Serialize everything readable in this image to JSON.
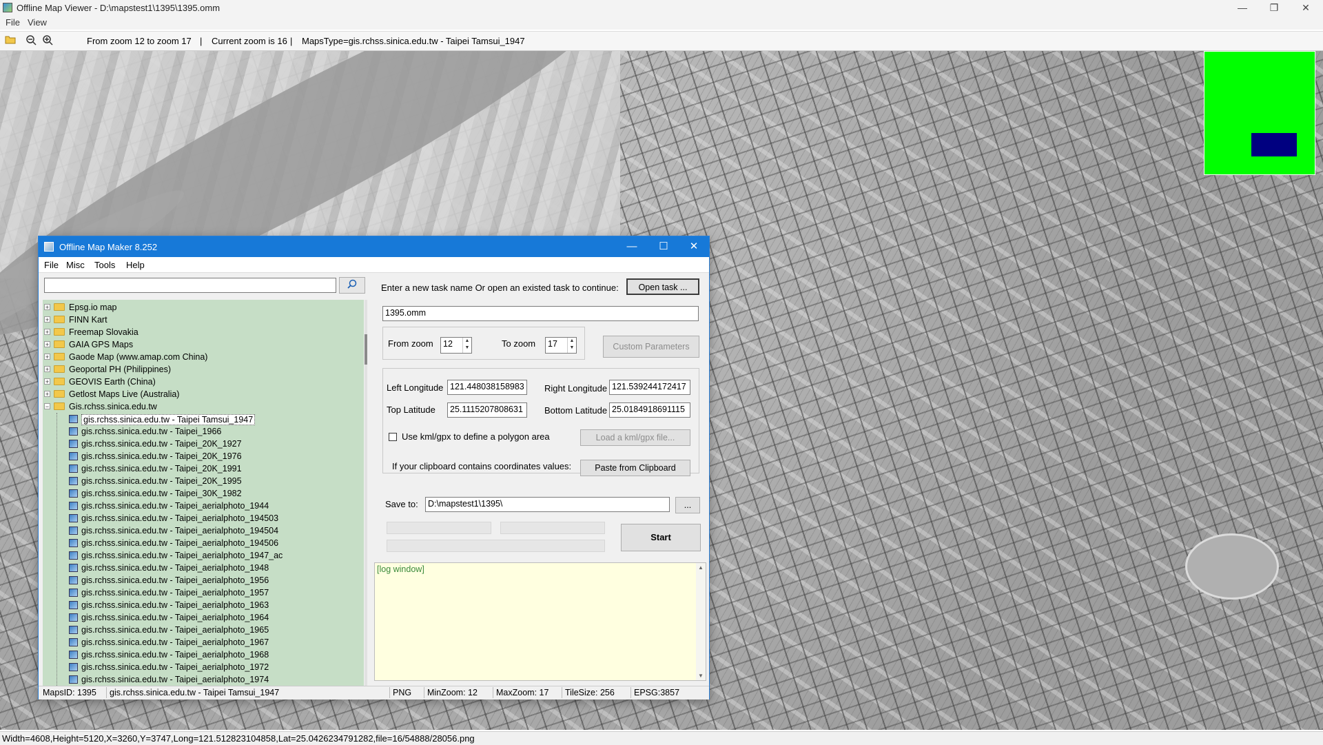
{
  "main_window": {
    "title": "Offline Map Viewer - D:\\mapstest1\\1395\\1395.omm",
    "menu": [
      "File",
      "View"
    ],
    "toolbar": {
      "zoom_range": "From zoom 12 to zoom 17",
      "current_zoom": "Current zoom is 16",
      "maps_type": "MapsType=gis.rchss.sinica.edu.tw - Taipei Tamsui_1947",
      "sep1": "|",
      "sep2": "|"
    },
    "window_controls": {
      "minimize": "—",
      "restore": "❐",
      "close": "✕"
    },
    "status": "Width=4608,Height=5120,X=3260,Y=3747,Long=121.512823104858,Lat=25.0426234791282,file=16/54888/28056.png",
    "minimap_colors": {
      "background": "#00ff00",
      "viewport": "#000080"
    }
  },
  "dialog": {
    "title": "Offline Map Maker 8.252",
    "menu": [
      "File",
      "Misc",
      "Tools",
      "Help"
    ],
    "search": {
      "value": "",
      "icon": "search-icon"
    },
    "tree": {
      "folders": [
        "Epsg.io map",
        "FINN Kart",
        "Freemap Slovakia",
        "GAIA GPS Maps",
        "Gaode Map (www.amap.com China)",
        "Geoportal PH (Philippines)",
        "GEOVIS Earth (China)",
        "Getlost Maps Live (Australia)"
      ],
      "expanded_folder": "Gis.rchss.sinica.edu.tw",
      "children": [
        "gis.rchss.sinica.edu.tw - Taipei Tamsui_1947",
        "gis.rchss.sinica.edu.tw - Taipei_1966",
        "gis.rchss.sinica.edu.tw - Taipei_20K_1927",
        "gis.rchss.sinica.edu.tw - Taipei_20K_1976",
        "gis.rchss.sinica.edu.tw - Taipei_20K_1991",
        "gis.rchss.sinica.edu.tw - Taipei_20K_1995",
        "gis.rchss.sinica.edu.tw - Taipei_30K_1982",
        "gis.rchss.sinica.edu.tw - Taipei_aerialphoto_1944",
        "gis.rchss.sinica.edu.tw - Taipei_aerialphoto_194503",
        "gis.rchss.sinica.edu.tw - Taipei_aerialphoto_194504",
        "gis.rchss.sinica.edu.tw - Taipei_aerialphoto_194506",
        "gis.rchss.sinica.edu.tw - Taipei_aerialphoto_1947_ac",
        "gis.rchss.sinica.edu.tw - Taipei_aerialphoto_1948",
        "gis.rchss.sinica.edu.tw - Taipei_aerialphoto_1956",
        "gis.rchss.sinica.edu.tw - Taipei_aerialphoto_1957",
        "gis.rchss.sinica.edu.tw - Taipei_aerialphoto_1963",
        "gis.rchss.sinica.edu.tw - Taipei_aerialphoto_1964",
        "gis.rchss.sinica.edu.tw - Taipei_aerialphoto_1965",
        "gis.rchss.sinica.edu.tw - Taipei_aerialphoto_1967",
        "gis.rchss.sinica.edu.tw - Taipei_aerialphoto_1968",
        "gis.rchss.sinica.edu.tw - Taipei_aerialphoto_1972",
        "gis.rchss.sinica.edu.tw - Taipei_aerialphoto_1974"
      ],
      "selected_index": 0
    },
    "task": {
      "prompt": "Enter a new task name Or open an existed task to continue:",
      "open_button": "Open task ...",
      "task_name": "1395.omm"
    },
    "zoom": {
      "from_label": "From zoom",
      "from_value": "12",
      "to_label": "To zoom",
      "to_value": "17",
      "custom_button": "Custom Parameters"
    },
    "coords": {
      "left_lon_label": "Left Longitude",
      "left_lon": "121.448038158983",
      "right_lon_label": "Right Longitude",
      "right_lon": "121.539244172417",
      "top_lat_label": "Top Latitude",
      "top_lat": "25.1115207808631",
      "bottom_lat_label": "Bottom Latitude",
      "bottom_lat": "25.0184918691115",
      "kml_checkbox": "Use kml/gpx to define a polygon area",
      "kml_checked": false,
      "load_kml_button": "Load a kml/gpx file...",
      "clipboard_label": "If your clipboard contains coordinates values:",
      "paste_button": "Paste from Clipboard"
    },
    "save": {
      "label": "Save to:",
      "path": "D:\\mapstest1\\1395\\",
      "browse_button": "...",
      "start_button": "Start"
    },
    "log": {
      "text": "[log window]"
    },
    "status": {
      "maps_id": "MapsID: 1395",
      "map_name": "gis.rchss.sinica.edu.tw - Taipei Tamsui_1947",
      "format": "PNG",
      "min_zoom": "MinZoom: 12",
      "max_zoom": "MaxZoom: 17",
      "tile_size": "TileSize: 256",
      "epsg": "EPSG:3857"
    }
  }
}
